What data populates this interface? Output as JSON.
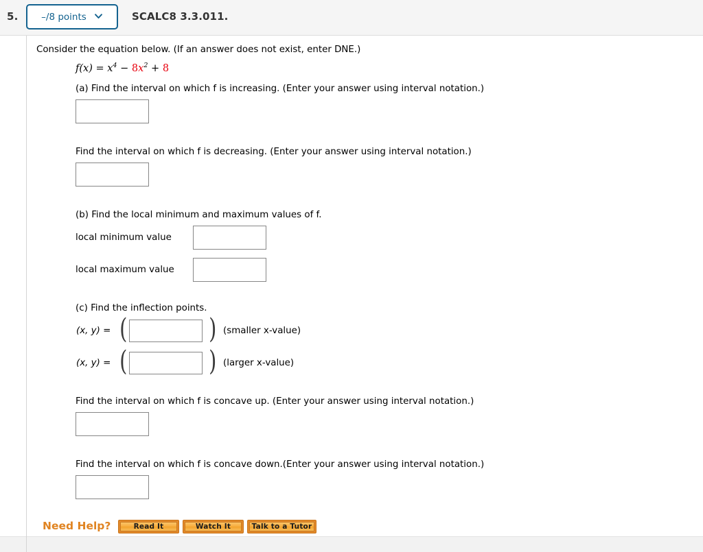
{
  "header": {
    "question_number": "5.",
    "points_badge": {
      "label": "–/8 points",
      "icon": "chevron-down-icon"
    },
    "assignment_id": "SCALC8 3.3.011."
  },
  "problem": {
    "intro": "Consider the equation below. (If an answer does not exist, enter DNE.)",
    "equation": {
      "lhs": "f(x) = ",
      "term1_base": "x",
      "term1_exp": "4",
      "operator1": " − ",
      "coefficient": "8",
      "term2_base": "x",
      "term2_exp": "2",
      "operator2": " + ",
      "constant": "8",
      "accent_color": "#e8000d",
      "plain": "f(x) = x^4 − 8x^2 + 8"
    },
    "parts": [
      {
        "id": "a-increasing",
        "prompt": "(a) Find the interval on which f is increasing. (Enter your answer using interval notation.)",
        "input_value": "",
        "input_placeholder": ""
      },
      {
        "id": "a-decreasing",
        "prompt": "Find the interval on which f is decreasing. (Enter your answer using interval notation.)",
        "input_value": "",
        "input_placeholder": ""
      }
    ],
    "part_b": {
      "prompt": "(b) Find the local minimum and maximum values of f.",
      "rows": [
        {
          "label": "local minimum value",
          "input_value": "",
          "input_placeholder": ""
        },
        {
          "label": "local maximum value",
          "input_value": "",
          "input_placeholder": ""
        }
      ]
    },
    "part_c": {
      "prompt": "(c) Find the inflection points.",
      "rows": [
        {
          "prefix": "(x, y) =",
          "open_paren": "(",
          "close_paren": ")",
          "suffix": "(smaller x-value)",
          "input_value": "",
          "input_placeholder": ""
        },
        {
          "prefix": "(x, y) =",
          "open_paren": "(",
          "close_paren": ")",
          "suffix": "(larger x-value)",
          "input_value": "",
          "input_placeholder": ""
        }
      ]
    },
    "part_concavity": [
      {
        "id": "concave-up",
        "prompt": "Find the interval on which f is concave up. (Enter your answer using interval notation.)",
        "input_value": "",
        "input_placeholder": ""
      },
      {
        "id": "concave-down",
        "prompt": "Find the interval on which f is concave down.(Enter your answer using interval notation.)",
        "input_value": "",
        "input_placeholder": ""
      }
    ]
  },
  "need_help": {
    "label": "Need Help?",
    "label_color": "#e08422",
    "buttons": [
      {
        "id": "read-it",
        "label": "Read It"
      },
      {
        "id": "watch-it",
        "label": "Watch It"
      },
      {
        "id": "talk-to-a-tutor",
        "label": "Talk to a Tutor"
      }
    ]
  }
}
